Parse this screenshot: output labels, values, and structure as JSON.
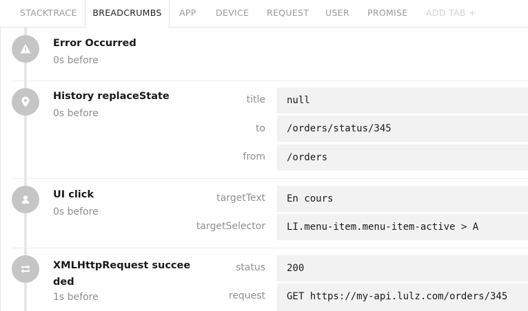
{
  "tabs": [
    "STACKTRACE",
    "BREADCRUMBS",
    "APP",
    "DEVICE",
    "REQUEST",
    "USER",
    "PROMISE",
    "ADD TAB +"
  ],
  "active_tab": "BREADCRUMBS",
  "breadcrumbs": [
    {
      "icon": "warning-icon",
      "title": "Error Occurred",
      "time": "0s before",
      "meta": []
    },
    {
      "icon": "location-pin-icon",
      "title": "History replaceState",
      "time": "0s before",
      "meta": [
        {
          "key": "title",
          "value": "null"
        },
        {
          "key": "to",
          "value": "/orders/status/345"
        },
        {
          "key": "from",
          "value": "/orders"
        }
      ]
    },
    {
      "icon": "user-icon",
      "title": "UI click",
      "time": "0s before",
      "meta": [
        {
          "key": "targetText",
          "value": "En cours"
        },
        {
          "key": "targetSelector",
          "value": "LI.menu-item.menu-item-active > A"
        }
      ]
    },
    {
      "icon": "refresh-arrows-icon",
      "title": "XMLHttpRequest succeeded",
      "title_lines": [
        "XMLHttpRequest succee",
        "ded"
      ],
      "time": "1s before",
      "meta": [
        {
          "key": "status",
          "value": "200"
        },
        {
          "key": "request",
          "value": "GET https://my-api.lulz.com/orders/345"
        }
      ]
    }
  ]
}
